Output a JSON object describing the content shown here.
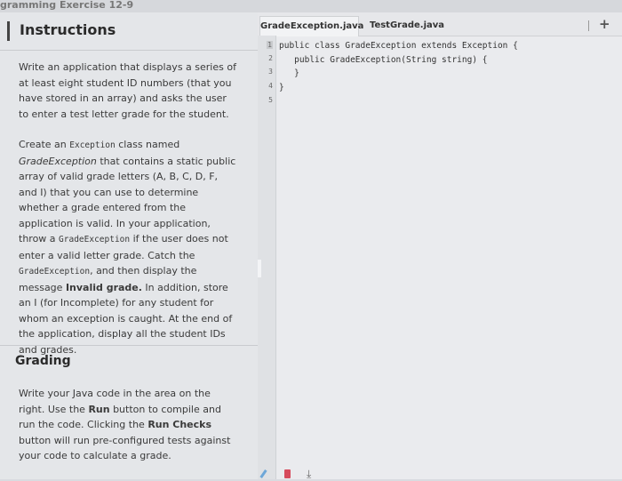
{
  "window": {
    "title": "gramming Exercise 12-9"
  },
  "instructions": {
    "title": "Instructions",
    "p1": "Write an application that displays a series of at least eight student ID numbers (that you have stored in an array) and asks the user to enter a test letter grade for the student.",
    "p2": {
      "t1": "Create an ",
      "c1": "Exception",
      "t2": " class named ",
      "e1": "GradeException",
      "t3": " that contains a static public array of valid grade letters (A, B, C, D, F, and I) that you can use to determine whether a grade entered from the application is valid. In your application, throw a ",
      "c2": "GradeException",
      "t4": " if the user does not enter a valid letter grade. Catch the ",
      "c3": "GradeException",
      "t5": ", and then display the message ",
      "b1": "Invalid grade.",
      "t6": " In addition, store an I (for Incomplete) for any student for whom an exception is caught. At the end of the application, display all the student IDs and grades."
    }
  },
  "grading": {
    "title": "Grading",
    "p": {
      "t1": "Write your Java code in the area on the right. Use the ",
      "b1": "Run",
      "t2": " button to compile and run the code. Clicking the ",
      "b2": "Run Checks",
      "t3": " button will run pre-configured tests against your code to calculate a grade."
    }
  },
  "editor": {
    "tabs": [
      "GradeException.java",
      "TestGrade.java"
    ],
    "add_tab": "+",
    "line_numbers": [
      "1",
      "2",
      "3",
      "4",
      "5"
    ],
    "lines": [
      "public class GradeException extends Exception {",
      "   public GradeException(String string) {",
      "   }",
      "}",
      ""
    ]
  },
  "icons": [
    "pencil-icon",
    "trash-icon",
    "download-icon"
  ]
}
